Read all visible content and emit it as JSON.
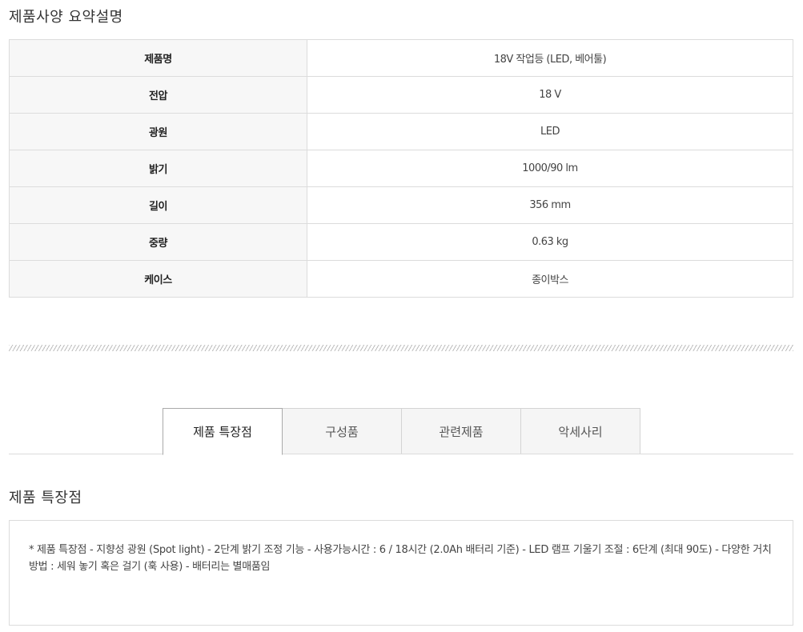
{
  "spec": {
    "title": "제품사양 요약설명",
    "rows": [
      {
        "label": "제품명",
        "value": "18V 작업등 (LED, 베어툴)"
      },
      {
        "label": "전압",
        "value": "18 V"
      },
      {
        "label": "광원",
        "value": "LED"
      },
      {
        "label": "밝기",
        "value": "1000/90 lm"
      },
      {
        "label": "길이",
        "value": "356 mm"
      },
      {
        "label": "중량",
        "value": "0.63 kg"
      },
      {
        "label": "케이스",
        "value": "종이박스"
      }
    ]
  },
  "tabs": [
    {
      "label": "제품 특장점",
      "active": true
    },
    {
      "label": "구성품",
      "active": false
    },
    {
      "label": "관련제품",
      "active": false
    },
    {
      "label": "악세사리",
      "active": false
    }
  ],
  "features": {
    "title": "제품 특장점",
    "text": "* 제품 특장점 - 지향성 광원 (Spot light) - 2단계 밝기 조정 기능 - 사용가능시간 : 6 / 18시간 (2.0Ah 배터리 기준) - LED 램프 기울기 조절 : 6단계 (최대 90도) - 다양한 거치 방법 : 세워 놓기 혹은 걸기 (훅 사용) - 배터리는 별매품임"
  },
  "colors": {
    "label_bg": "#f7f7f7",
    "border": "#dcdcdc",
    "text": "#333333"
  }
}
